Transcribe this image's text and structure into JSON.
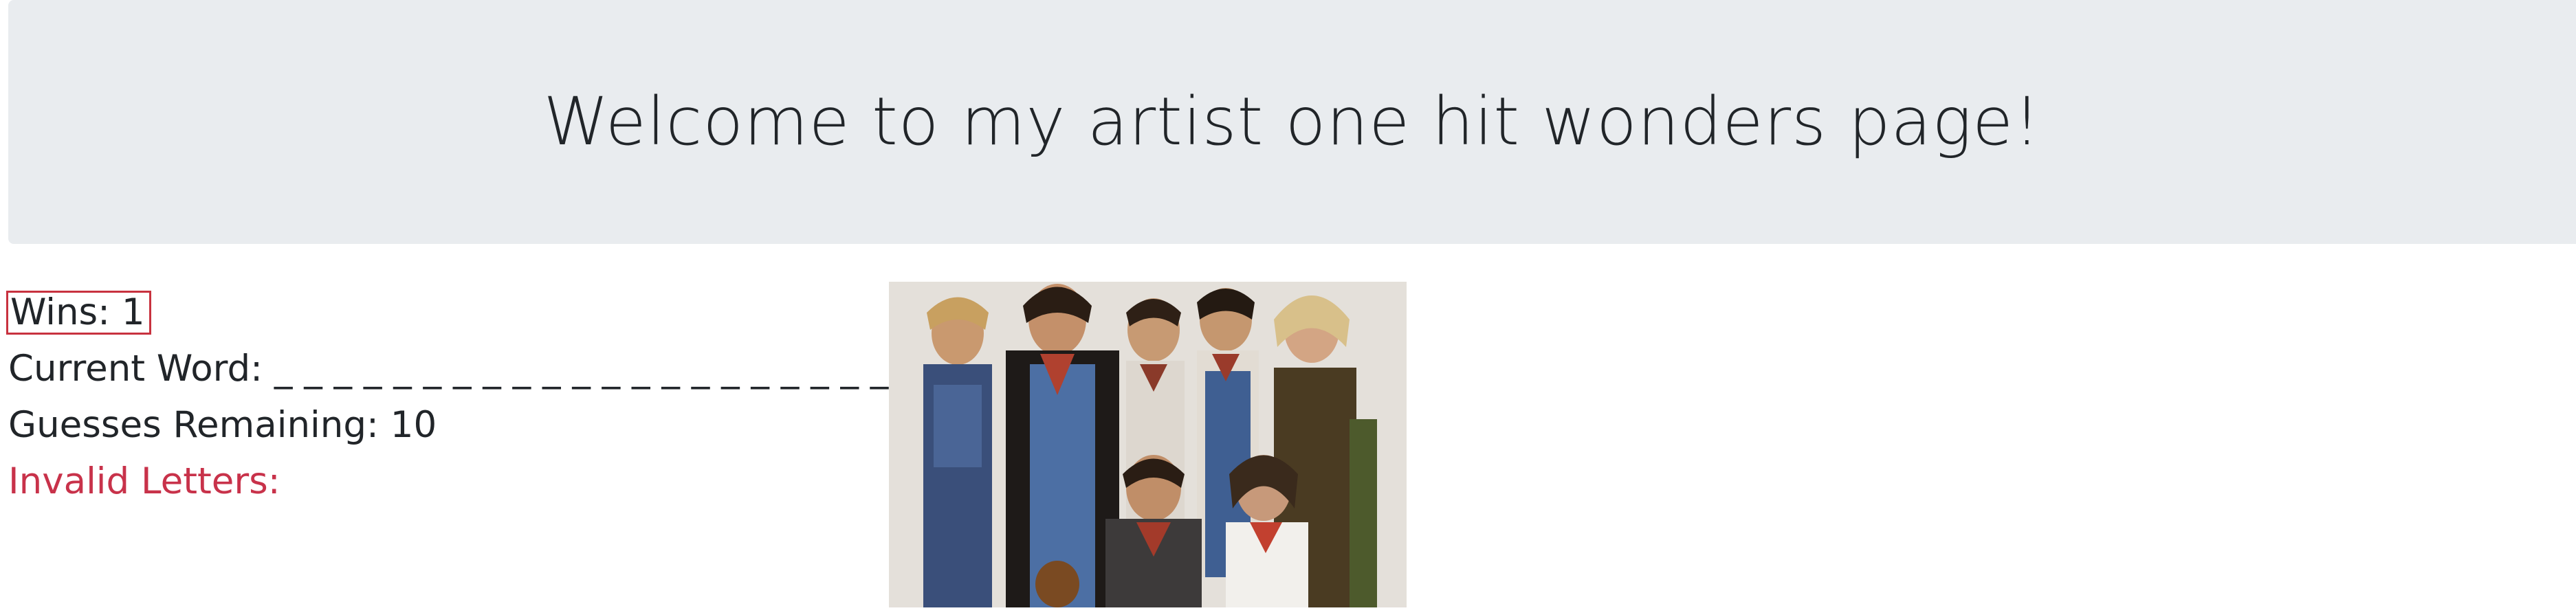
{
  "header": {
    "title": "Welcome to my artist one hit wonders page!"
  },
  "game": {
    "wins_label": "Wins:",
    "wins_value": "1",
    "current_word_label": "Current Word:",
    "current_word_value": "_ _ _ _ _ _ _ _ _ _ _ _ _ _ _ _ _ _ _ _ _",
    "guesses_label": "Guesses Remaining:",
    "guesses_value": "10",
    "invalid_label": "Invalid Letters:",
    "invalid_value": ""
  },
  "image": {
    "icon": "band-photo"
  },
  "colors": {
    "jumbotron_bg": "#e9ecef",
    "invalid_red": "#c8324a",
    "wins_border": "#c8323f"
  }
}
